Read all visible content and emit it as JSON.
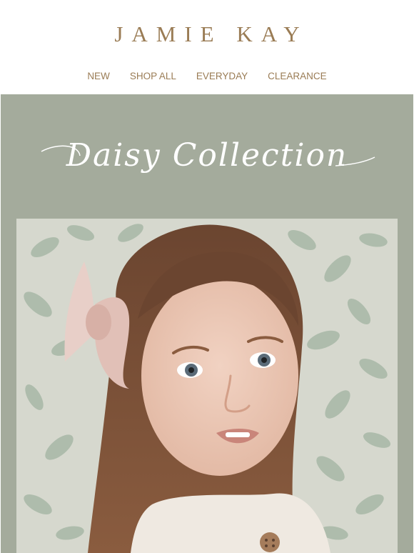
{
  "brand": {
    "logo_text": "JAMIE KAY",
    "accent_color": "#9a7c55",
    "hero_bg_color": "#a4ab9c"
  },
  "nav": {
    "items": [
      {
        "label": "NEW"
      },
      {
        "label": "SHOP ALL"
      },
      {
        "label": "EVERYDAY"
      },
      {
        "label": "CLEARANCE"
      }
    ]
  },
  "hero": {
    "title": "Daisy Collection"
  },
  "photo": {
    "subject": "girl-with-pink-bow-photo"
  }
}
